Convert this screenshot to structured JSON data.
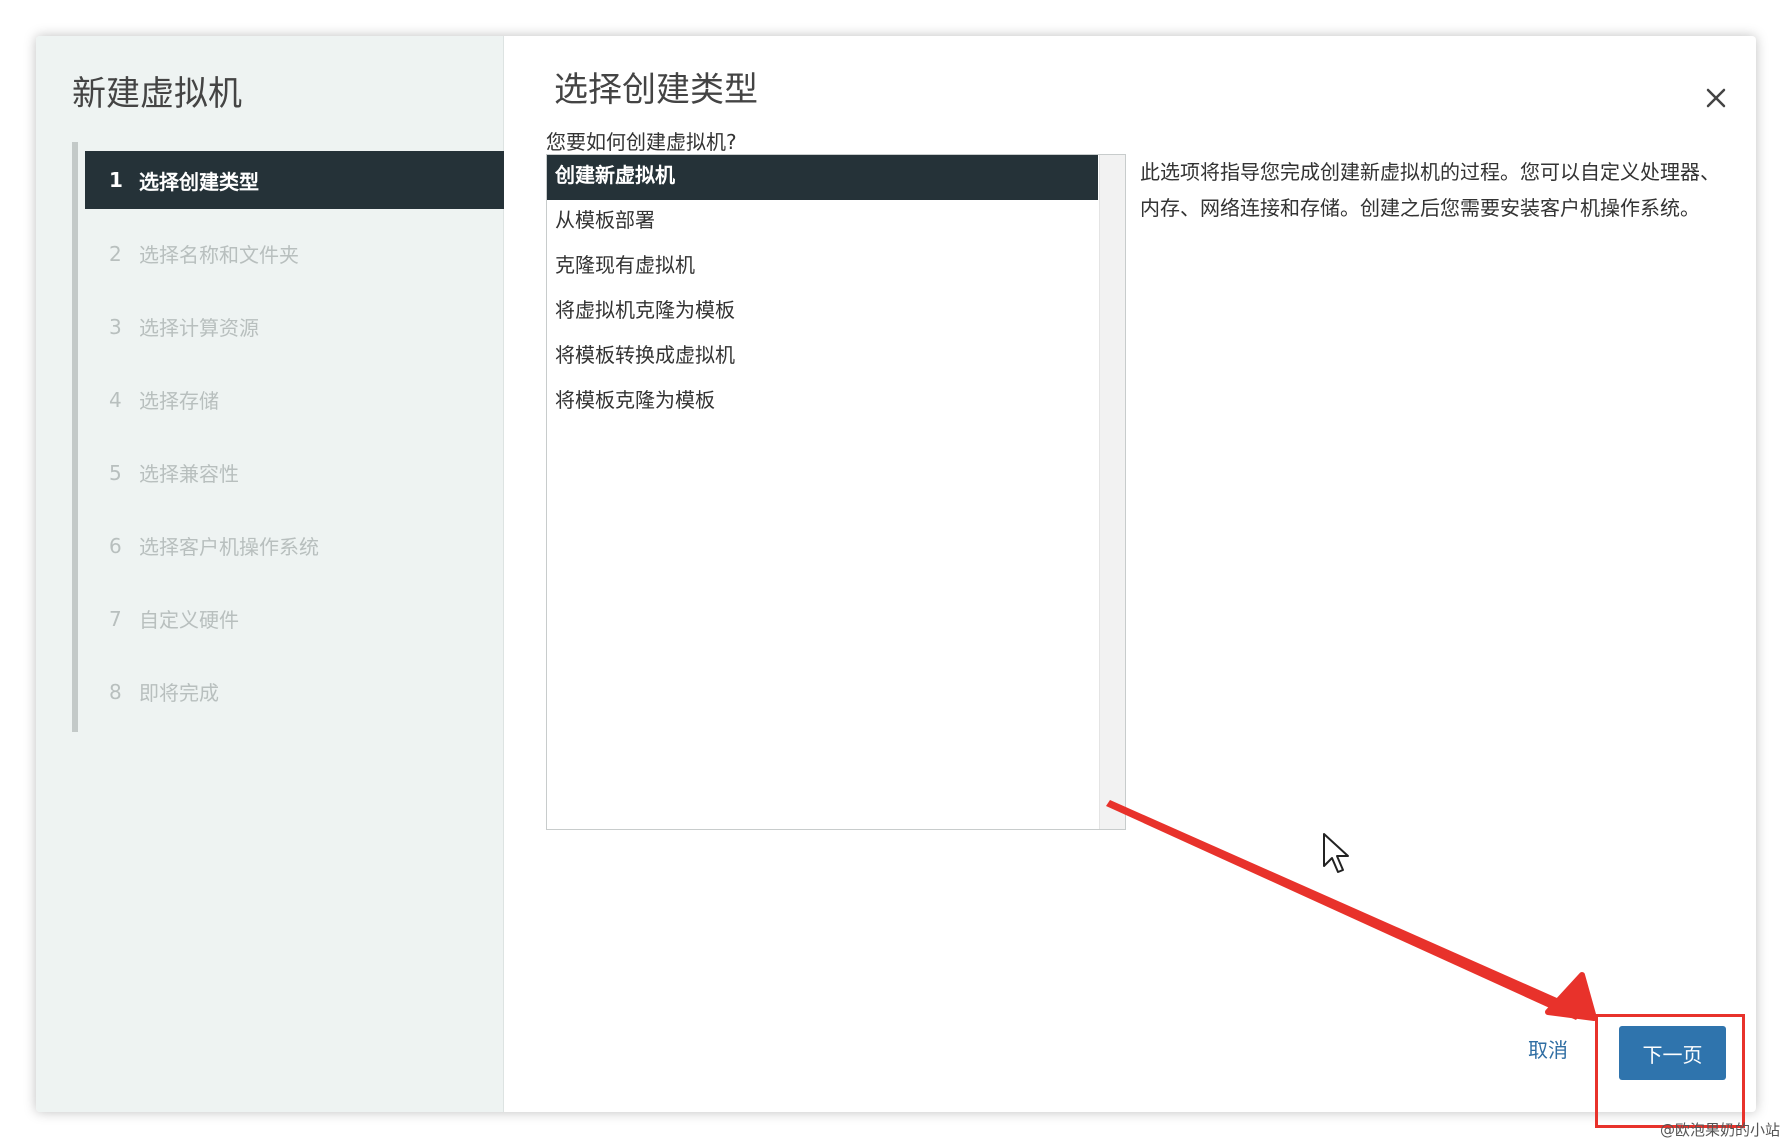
{
  "sidebar": {
    "title": "新建虚拟机",
    "steps": [
      {
        "num": "1",
        "label": "选择创建类型"
      },
      {
        "num": "2",
        "label": "选择名称和文件夹"
      },
      {
        "num": "3",
        "label": "选择计算资源"
      },
      {
        "num": "4",
        "label": "选择存储"
      },
      {
        "num": "5",
        "label": "选择兼容性"
      },
      {
        "num": "6",
        "label": "选择客户机操作系统"
      },
      {
        "num": "7",
        "label": "自定义硬件"
      },
      {
        "num": "8",
        "label": "即将完成"
      }
    ]
  },
  "main": {
    "title": "选择创建类型",
    "question": "您要如何创建虚拟机?",
    "options": [
      "创建新虚拟机",
      "从模板部署",
      "克隆现有虚拟机",
      "将虚拟机克隆为模板",
      "将模板转换成虚拟机",
      "将模板克隆为模板"
    ],
    "description": "此选项将指导您完成创建新虚拟机的过程。您可以自定义处理器、内存、网络连接和存储。创建之后您需要安装客户机操作系统。"
  },
  "footer": {
    "cancel_label": "取消",
    "next_label": "下一页"
  },
  "watermark": "@欧泡果奶的小站",
  "colors": {
    "accent": "#2f74ad",
    "selected_bg": "#253238",
    "annotation": "#e8322b"
  }
}
